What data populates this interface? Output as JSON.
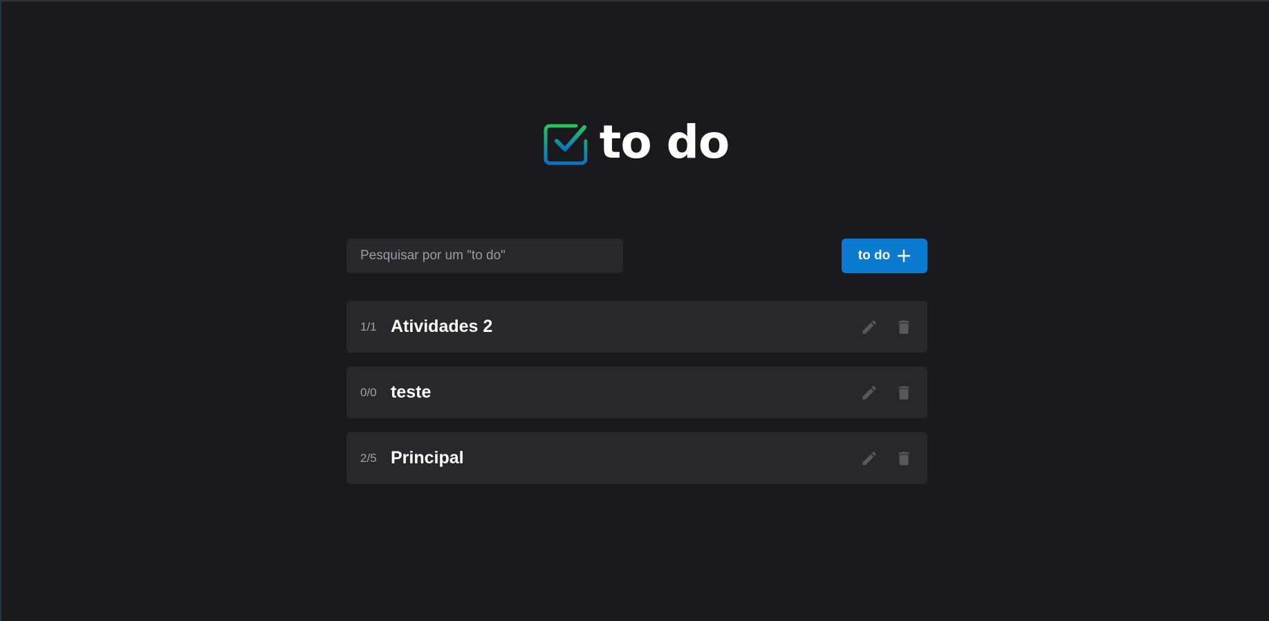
{
  "header": {
    "logo_icon": "checkbox-checked-icon",
    "title": "to do",
    "gradient_top": "#22c55e",
    "gradient_bottom": "#0b74c4"
  },
  "toolbar": {
    "search_placeholder": "Pesquisar por um \"to do\"",
    "search_value": "",
    "add_label": "to do",
    "add_icon": "plus-icon",
    "accent": "#0b7bd0"
  },
  "lists": [
    {
      "count": "1/1",
      "title": "Atividades 2",
      "edit_icon": "pencil-icon",
      "delete_icon": "trash-icon"
    },
    {
      "count": "0/0",
      "title": "teste",
      "edit_icon": "pencil-icon",
      "delete_icon": "trash-icon"
    },
    {
      "count": "2/5",
      "title": "Principal",
      "edit_icon": "pencil-icon",
      "delete_icon": "trash-icon"
    }
  ]
}
